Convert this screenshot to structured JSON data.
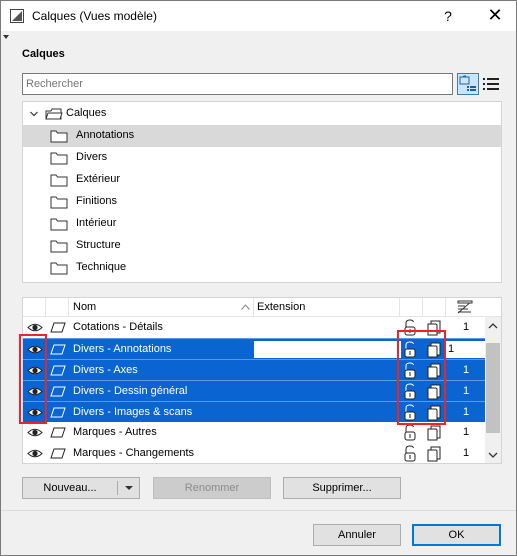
{
  "window": {
    "title": "Calques (Vues modèle)",
    "help_label": "?",
    "close_label": "✕"
  },
  "section_label": "Calques",
  "search": {
    "placeholder": "Rechercher"
  },
  "tree": {
    "root_label": "Calques",
    "folders": [
      {
        "label": "Annotations",
        "selected": true
      },
      {
        "label": "Divers",
        "selected": false
      },
      {
        "label": "Extérieur",
        "selected": false
      },
      {
        "label": "Finitions",
        "selected": false
      },
      {
        "label": "Intérieur",
        "selected": false
      },
      {
        "label": "Structure",
        "selected": false
      },
      {
        "label": "Technique",
        "selected": false
      }
    ]
  },
  "list": {
    "headers": {
      "name": "Nom",
      "extension": "Extension"
    },
    "rows": [
      {
        "name": "Cotations - Détails",
        "num": "1",
        "selected": false
      },
      {
        "name": "Divers - Annotations",
        "num": "1",
        "selected": true,
        "editing": true
      },
      {
        "name": "Divers - Axes",
        "num": "1",
        "selected": true
      },
      {
        "name": "Divers - Dessin général",
        "num": "1",
        "selected": true
      },
      {
        "name": "Divers - Images & scans",
        "num": "1",
        "selected": true
      },
      {
        "name": "Marques - Autres",
        "num": "1",
        "selected": false
      },
      {
        "name": "Marques - Changements",
        "num": "1",
        "selected": false
      }
    ]
  },
  "buttons": {
    "new": "Nouveau...",
    "rename": "Renommer",
    "delete": "Supprimer...",
    "cancel": "Annuler",
    "ok": "OK"
  },
  "colors": {
    "selection": "#0a64d2",
    "highlight_box": "#e8262a",
    "tree_selection": "#d9d9d9"
  },
  "icons": {
    "eye": "eye-icon",
    "layer": "layer-plane-icon",
    "lock": "lock-icon",
    "document": "document-icon",
    "folder": "folder-icon"
  }
}
